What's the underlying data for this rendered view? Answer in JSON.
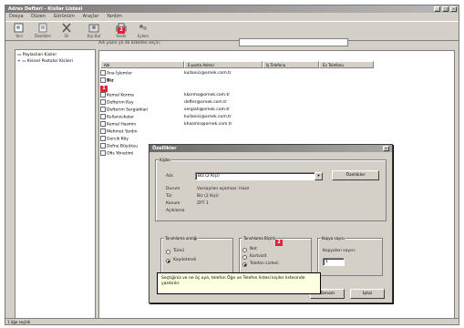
{
  "window": {
    "title": "Adres Defteri - Kisiler Listesi"
  },
  "menu": [
    "Dosya",
    "Düzen",
    "Görünüm",
    "Araçlar",
    "Yardım"
  ],
  "toolbar": [
    {
      "label": "Yeni",
      "icon": "new-contact-icon"
    },
    {
      "label": "Özellikler",
      "icon": "properties-icon"
    },
    {
      "label": "Sil",
      "icon": "delete-icon"
    },
    {
      "label": "Kişi Bul",
      "icon": "find-people-icon"
    },
    {
      "label": "Yazdır",
      "icon": "print-icon"
    },
    {
      "label": "Eylem",
      "icon": "action-icon"
    }
  ],
  "tree": {
    "items": [
      "Paylasilan Kisiler",
      "Kisisel Postalar Kisileri"
    ]
  },
  "filter": {
    "label": "Adı yazın ya da listeden seçin:",
    "value": ""
  },
  "columns": [
    "Adı",
    "E-posta Adresi",
    "İş Telefonu",
    "Ev Telefonu"
  ],
  "rows": [
    {
      "name": "Ana İşlemler",
      "email": "kullanici@ornek.com.tr"
    },
    {
      "name": "Biz",
      "email": ""
    },
    {
      "name": "Kemal Korma",
      "email": "kkorma@ornek.com.tr"
    },
    {
      "name": "Defterim Kay",
      "email": "defter@ornek.com.tr"
    },
    {
      "name": "Defterim Sergiahlari",
      "email": "sergiah@ornek.com.tr"
    },
    {
      "name": "Kullanıcıkalar",
      "email": "kullanici@ornek.com.tr"
    },
    {
      "name": "Kemal Hasmin",
      "email": "khasmin@ornek.com.tr"
    },
    {
      "name": "Mehmet Yardin",
      "email": ""
    },
    {
      "name": "Gercik Köy",
      "email": ""
    },
    {
      "name": "Defne Büyüksu",
      "email": ""
    },
    {
      "name": "Ofis Yönetimi",
      "email": ""
    }
  ],
  "dialog": {
    "title": "Özellikler",
    "kisiler_group": "Kişiler",
    "adi_label": "Adı:",
    "adi_value": "Biz (2 Kişi)",
    "ozellikler_btn": "Özellikler",
    "info": [
      {
        "k": "Durum",
        "v": "Varsayılan aşaması: Hazır"
      },
      {
        "k": "Tür",
        "v": "Biz (2 Kişi)"
      },
      {
        "k": "Konum",
        "v": "ZPT 1"
      },
      {
        "k": "Açıklama",
        "v": ""
      }
    ],
    "group1": {
      "title": "Tanımlama aralığı",
      "opts": [
        "Tümü",
        "Kaydetmeli"
      ],
      "selected": 1
    },
    "group2": {
      "title": "Tanımlama Biçimi",
      "opts": [
        "Not",
        "Kartvizit",
        "Telefon Listesi"
      ],
      "selected": 2
    },
    "group3": {
      "title": "Kopya sayısı",
      "label": "Kopyaları sayısı:",
      "value": "1"
    },
    "ok": "Tamam",
    "cancel": "İptal"
  },
  "tooltip": "Seçtiğiniz ve ne öç uye, telefon Öğe ve Telefon listesi kişiler listesinde yazdırılır.",
  "badges": [
    "1",
    "2"
  ],
  "status": "1 öğe seçildi"
}
